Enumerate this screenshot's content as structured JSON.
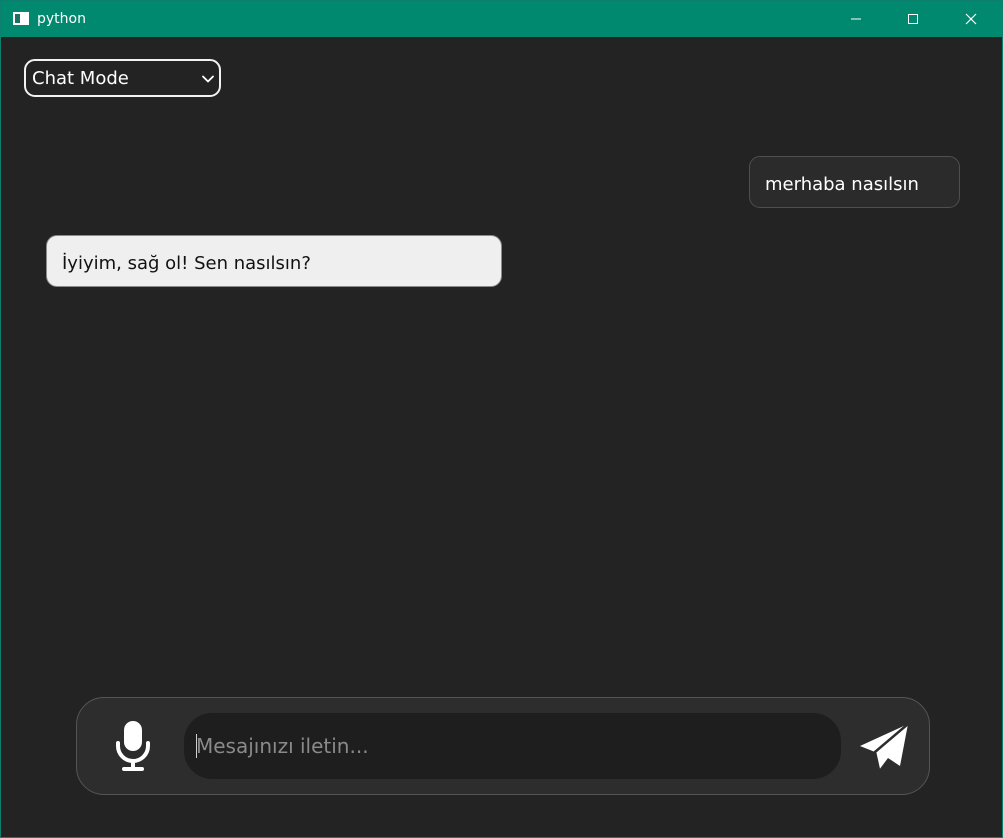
{
  "window": {
    "title": "python",
    "icon": "app-window-icon",
    "controls": {
      "minimize": "minimize-icon",
      "maximize": "maximize-icon",
      "close": "close-icon"
    },
    "titlebar_color": "#00896f"
  },
  "mode_select": {
    "selected": "Chat Mode",
    "icon": "chevron-down-icon"
  },
  "messages": [
    {
      "role": "user",
      "text": "merhaba nasılsın"
    },
    {
      "role": "assistant",
      "text": "İyiyim, sağ ol! Sen nasılsın?"
    }
  ],
  "composer": {
    "placeholder": "Mesajınızı iletin...",
    "value": "",
    "mic_icon": "microphone-icon",
    "send_icon": "paper-plane-icon"
  },
  "colors": {
    "background": "#232323",
    "user_bubble": "#2b2b2b",
    "assistant_bubble": "#efefef",
    "composer": "#2d2d2d",
    "input": "#1e1e1e"
  }
}
